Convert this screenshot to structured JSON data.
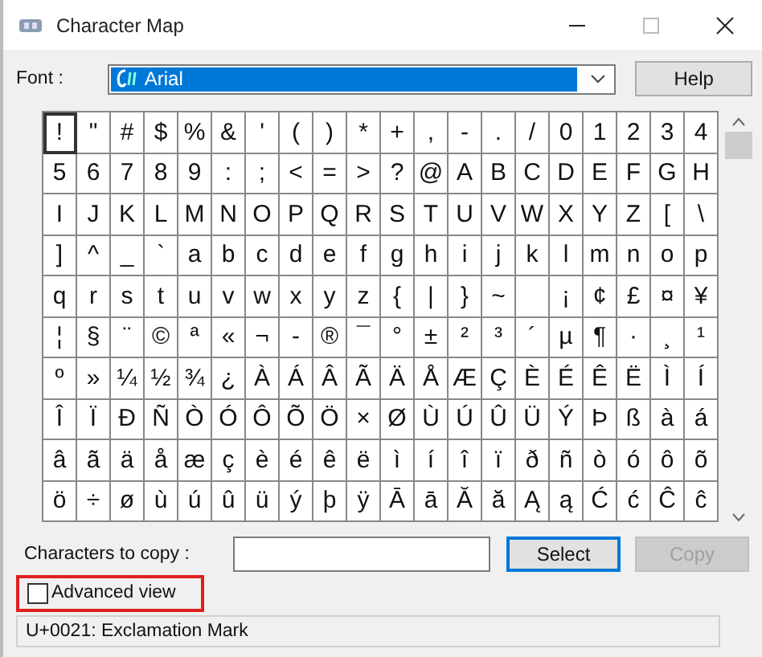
{
  "window": {
    "title": "Character Map"
  },
  "font": {
    "label": "Font :",
    "value": "Arial"
  },
  "help_button": "Help",
  "grid": [
    {
      "cells": [
        {
          "char": "!",
          "selected": true
        },
        {
          "char": "\"",
          "selected": false
        },
        {
          "char": "#",
          "selected": false
        },
        {
          "char": "$",
          "selected": false
        },
        {
          "char": "%",
          "selected": false
        },
        {
          "char": "&",
          "selected": false
        },
        {
          "char": "'",
          "selected": false
        },
        {
          "char": "(",
          "selected": false
        },
        {
          "char": ")",
          "selected": false
        },
        {
          "char": "*",
          "selected": false
        },
        {
          "char": "+",
          "selected": false
        },
        {
          "char": ",",
          "selected": false
        },
        {
          "char": "-",
          "selected": false
        },
        {
          "char": ".",
          "selected": false
        },
        {
          "char": "/",
          "selected": false
        },
        {
          "char": "0",
          "selected": false
        },
        {
          "char": "1",
          "selected": false
        },
        {
          "char": "2",
          "selected": false
        },
        {
          "char": "3",
          "selected": false
        },
        {
          "char": "4",
          "selected": false
        }
      ]
    },
    {
      "cells": [
        {
          "char": "5",
          "selected": false
        },
        {
          "char": "6",
          "selected": false
        },
        {
          "char": "7",
          "selected": false
        },
        {
          "char": "8",
          "selected": false
        },
        {
          "char": "9",
          "selected": false
        },
        {
          "char": ":",
          "selected": false
        },
        {
          "char": ";",
          "selected": false
        },
        {
          "char": "<",
          "selected": false
        },
        {
          "char": "=",
          "selected": false
        },
        {
          "char": ">",
          "selected": false
        },
        {
          "char": "?",
          "selected": false
        },
        {
          "char": "@",
          "selected": false
        },
        {
          "char": "A",
          "selected": false
        },
        {
          "char": "B",
          "selected": false
        },
        {
          "char": "C",
          "selected": false
        },
        {
          "char": "D",
          "selected": false
        },
        {
          "char": "E",
          "selected": false
        },
        {
          "char": "F",
          "selected": false
        },
        {
          "char": "G",
          "selected": false
        },
        {
          "char": "H",
          "selected": false
        }
      ]
    },
    {
      "cells": [
        {
          "char": "I",
          "selected": false
        },
        {
          "char": "J",
          "selected": false
        },
        {
          "char": "K",
          "selected": false
        },
        {
          "char": "L",
          "selected": false
        },
        {
          "char": "M",
          "selected": false
        },
        {
          "char": "N",
          "selected": false
        },
        {
          "char": "O",
          "selected": false
        },
        {
          "char": "P",
          "selected": false
        },
        {
          "char": "Q",
          "selected": false
        },
        {
          "char": "R",
          "selected": false
        },
        {
          "char": "S",
          "selected": false
        },
        {
          "char": "T",
          "selected": false
        },
        {
          "char": "U",
          "selected": false
        },
        {
          "char": "V",
          "selected": false
        },
        {
          "char": "W",
          "selected": false
        },
        {
          "char": "X",
          "selected": false
        },
        {
          "char": "Y",
          "selected": false
        },
        {
          "char": "Z",
          "selected": false
        },
        {
          "char": "[",
          "selected": false
        },
        {
          "char": "\\",
          "selected": false
        }
      ]
    },
    {
      "cells": [
        {
          "char": "]",
          "selected": false
        },
        {
          "char": "^",
          "selected": false
        },
        {
          "char": "_",
          "selected": false
        },
        {
          "char": "`",
          "selected": false
        },
        {
          "char": "a",
          "selected": false
        },
        {
          "char": "b",
          "selected": false
        },
        {
          "char": "c",
          "selected": false
        },
        {
          "char": "d",
          "selected": false
        },
        {
          "char": "e",
          "selected": false
        },
        {
          "char": "f",
          "selected": false
        },
        {
          "char": "g",
          "selected": false
        },
        {
          "char": "h",
          "selected": false
        },
        {
          "char": "i",
          "selected": false
        },
        {
          "char": "j",
          "selected": false
        },
        {
          "char": "k",
          "selected": false
        },
        {
          "char": "l",
          "selected": false
        },
        {
          "char": "m",
          "selected": false
        },
        {
          "char": "n",
          "selected": false
        },
        {
          "char": "o",
          "selected": false
        },
        {
          "char": "p",
          "selected": false
        }
      ]
    },
    {
      "cells": [
        {
          "char": "q",
          "selected": false
        },
        {
          "char": "r",
          "selected": false
        },
        {
          "char": "s",
          "selected": false
        },
        {
          "char": "t",
          "selected": false
        },
        {
          "char": "u",
          "selected": false
        },
        {
          "char": "v",
          "selected": false
        },
        {
          "char": "w",
          "selected": false
        },
        {
          "char": "x",
          "selected": false
        },
        {
          "char": "y",
          "selected": false
        },
        {
          "char": "z",
          "selected": false
        },
        {
          "char": "{",
          "selected": false
        },
        {
          "char": "|",
          "selected": false
        },
        {
          "char": "}",
          "selected": false
        },
        {
          "char": "~",
          "selected": false
        },
        {
          "selected": false
        },
        {
          "char": "¡",
          "selected": false
        },
        {
          "char": "¢",
          "selected": false
        },
        {
          "char": "£",
          "selected": false
        },
        {
          "char": "¤",
          "selected": false
        },
        {
          "char": "¥",
          "selected": false
        }
      ]
    },
    {
      "cells": [
        {
          "char": "¦",
          "selected": false
        },
        {
          "char": "§",
          "selected": false
        },
        {
          "char": "¨",
          "selected": false
        },
        {
          "char": "©",
          "selected": false
        },
        {
          "char": "ª",
          "selected": false
        },
        {
          "char": "«",
          "selected": false
        },
        {
          "char": "¬",
          "selected": false
        },
        {
          "char": "-",
          "selected": false
        },
        {
          "char": "®",
          "selected": false
        },
        {
          "char": "¯",
          "selected": false
        },
        {
          "char": "°",
          "selected": false
        },
        {
          "char": "±",
          "selected": false
        },
        {
          "char": "²",
          "selected": false
        },
        {
          "char": "³",
          "selected": false
        },
        {
          "char": "´",
          "selected": false
        },
        {
          "char": "µ",
          "selected": false
        },
        {
          "char": "¶",
          "selected": false
        },
        {
          "char": "·",
          "selected": false
        },
        {
          "char": "¸",
          "selected": false
        },
        {
          "char": "¹",
          "selected": false
        }
      ]
    },
    {
      "cells": [
        {
          "char": "º",
          "selected": false
        },
        {
          "char": "»",
          "selected": false
        },
        {
          "char": "¼",
          "selected": false
        },
        {
          "char": "½",
          "selected": false
        },
        {
          "char": "¾",
          "selected": false
        },
        {
          "char": "¿",
          "selected": false
        },
        {
          "char": "À",
          "selected": false
        },
        {
          "char": "Á",
          "selected": false
        },
        {
          "char": "Â",
          "selected": false
        },
        {
          "char": "Ã",
          "selected": false
        },
        {
          "char": "Ä",
          "selected": false
        },
        {
          "char": "Å",
          "selected": false
        },
        {
          "char": "Æ",
          "selected": false
        },
        {
          "char": "Ç",
          "selected": false
        },
        {
          "char": "È",
          "selected": false
        },
        {
          "char": "É",
          "selected": false
        },
        {
          "char": "Ê",
          "selected": false
        },
        {
          "char": "Ë",
          "selected": false
        },
        {
          "char": "Ì",
          "selected": false
        },
        {
          "char": "Í",
          "selected": false
        }
      ]
    },
    {
      "cells": [
        {
          "char": "Î",
          "selected": false
        },
        {
          "char": "Ï",
          "selected": false
        },
        {
          "char": "Ð",
          "selected": false
        },
        {
          "char": "Ñ",
          "selected": false
        },
        {
          "char": "Ò",
          "selected": false
        },
        {
          "char": "Ó",
          "selected": false
        },
        {
          "char": "Ô",
          "selected": false
        },
        {
          "char": "Õ",
          "selected": false
        },
        {
          "char": "Ö",
          "selected": false
        },
        {
          "char": "×",
          "selected": false
        },
        {
          "char": "Ø",
          "selected": false
        },
        {
          "char": "Ù",
          "selected": false
        },
        {
          "char": "Ú",
          "selected": false
        },
        {
          "char": "Û",
          "selected": false
        },
        {
          "char": "Ü",
          "selected": false
        },
        {
          "char": "Ý",
          "selected": false
        },
        {
          "char": "Þ",
          "selected": false
        },
        {
          "char": "ß",
          "selected": false
        },
        {
          "char": "à",
          "selected": false
        },
        {
          "char": "á",
          "selected": false
        }
      ]
    },
    {
      "cells": [
        {
          "char": "â",
          "selected": false
        },
        {
          "char": "ã",
          "selected": false
        },
        {
          "char": "ä",
          "selected": false
        },
        {
          "char": "å",
          "selected": false
        },
        {
          "char": "æ",
          "selected": false
        },
        {
          "char": "ç",
          "selected": false
        },
        {
          "char": "è",
          "selected": false
        },
        {
          "char": "é",
          "selected": false
        },
        {
          "char": "ê",
          "selected": false
        },
        {
          "char": "ë",
          "selected": false
        },
        {
          "char": "ì",
          "selected": false
        },
        {
          "char": "í",
          "selected": false
        },
        {
          "char": "î",
          "selected": false
        },
        {
          "char": "ï",
          "selected": false
        },
        {
          "char": "ð",
          "selected": false
        },
        {
          "char": "ñ",
          "selected": false
        },
        {
          "char": "ò",
          "selected": false
        },
        {
          "char": "ó",
          "selected": false
        },
        {
          "char": "ô",
          "selected": false
        },
        {
          "char": "õ",
          "selected": false
        }
      ]
    },
    {
      "cells": [
        {
          "char": "ö",
          "selected": false
        },
        {
          "char": "÷",
          "selected": false
        },
        {
          "char": "ø",
          "selected": false
        },
        {
          "char": "ù",
          "selected": false
        },
        {
          "char": "ú",
          "selected": false
        },
        {
          "char": "û",
          "selected": false
        },
        {
          "char": "ü",
          "selected": false
        },
        {
          "char": "ý",
          "selected": false
        },
        {
          "char": "þ",
          "selected": false
        },
        {
          "char": "ÿ",
          "selected": false
        },
        {
          "char": "Ā",
          "selected": false
        },
        {
          "char": "ā",
          "selected": false
        },
        {
          "char": "Ă",
          "selected": false
        },
        {
          "char": "ă",
          "selected": false
        },
        {
          "char": "Ą",
          "selected": false
        },
        {
          "char": "ą",
          "selected": false
        },
        {
          "char": "Ć",
          "selected": false
        },
        {
          "char": "ć",
          "selected": false
        },
        {
          "char": "Ĉ",
          "selected": false
        },
        {
          "char": "ĉ",
          "selected": false
        }
      ]
    }
  ],
  "copy_row": {
    "label": "Characters to copy :",
    "select_button": "Select",
    "copy_button": {
      "label": "Copy",
      "disabled": true
    }
  },
  "advanced_view": {
    "label": "Advanced view",
    "checked": false,
    "highlighted": true
  },
  "status_bar": "U+0021: Exclamation Mark"
}
